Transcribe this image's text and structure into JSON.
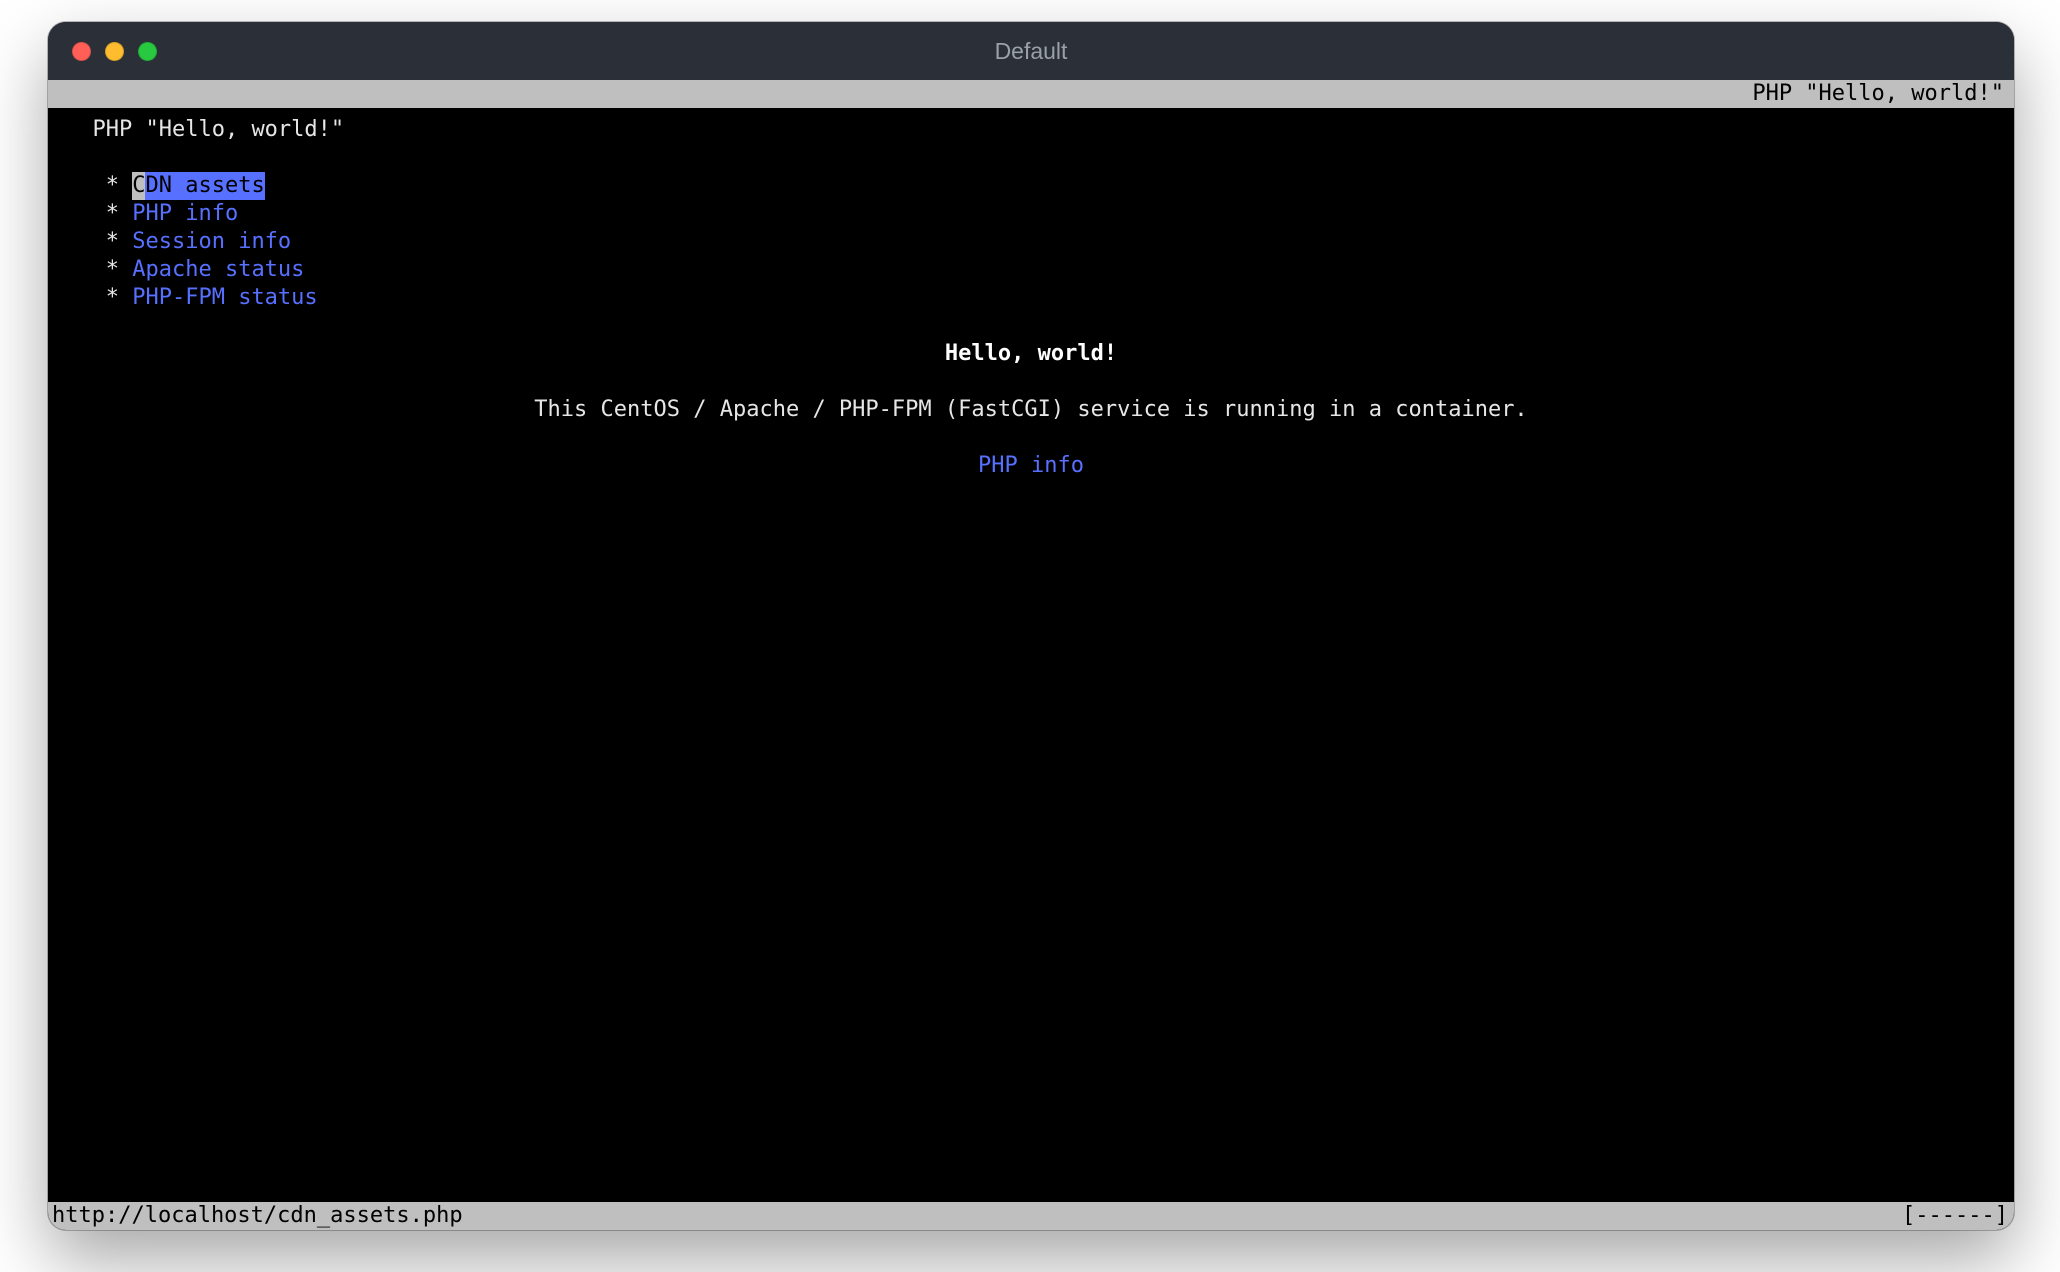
{
  "window": {
    "title": "Default"
  },
  "tabbar": {
    "label": "PHP \"Hello, world!\""
  },
  "page": {
    "title": "PHP \"Hello, world!\"",
    "menu_prefix": "   * ",
    "menu": [
      {
        "label": "CDN assets",
        "selected": true
      },
      {
        "label": "PHP info",
        "selected": false
      },
      {
        "label": "Session info",
        "selected": false
      },
      {
        "label": "Apache status",
        "selected": false
      },
      {
        "label": "PHP-FPM status",
        "selected": false
      }
    ],
    "center": {
      "heading": "Hello, world!",
      "description": "This CentOS / Apache / PHP-FPM (FastCGI) service is running in a container.",
      "link": "PHP info"
    }
  },
  "statusbar": {
    "url": "http://localhost/cdn_assets.php",
    "indicator": "[------]"
  }
}
